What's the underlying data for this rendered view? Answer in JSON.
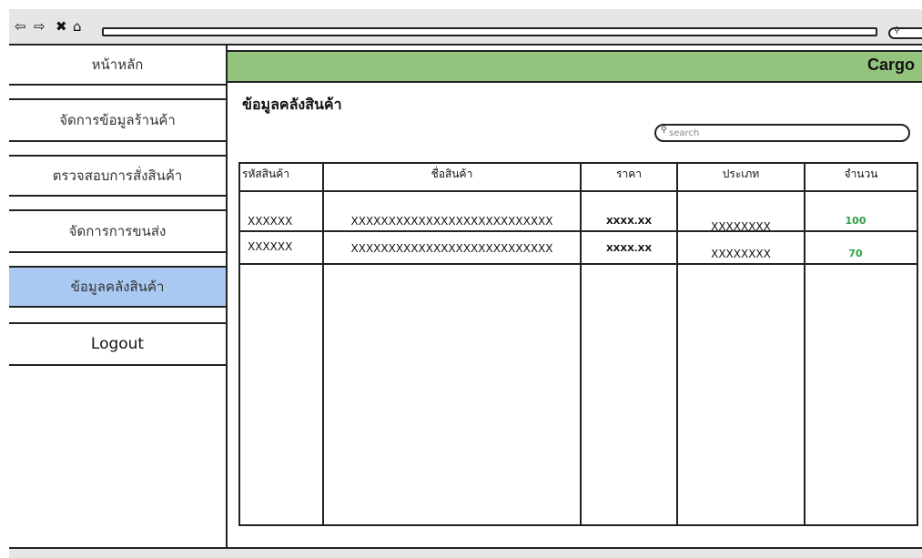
{
  "browser": {
    "icons": [
      "back-arrow-icon",
      "forward-arrow-icon",
      "close-icon",
      "home-icon",
      "search-icon"
    ]
  },
  "sidebar": {
    "items": [
      {
        "label": "หน้าหลัก",
        "active": false
      },
      {
        "label": "จัดการข้อมูลร้านค้า",
        "active": false
      },
      {
        "label": "ตรวจสอบการสั่งสินค้า",
        "active": false
      },
      {
        "label": "จัดการการขนส่ง",
        "active": false
      },
      {
        "label": "ข้อมูลคลังสินค้า",
        "active": true
      },
      {
        "label": "Logout",
        "active": false
      }
    ]
  },
  "header": {
    "brand": "Cargo",
    "color": "#93c47d"
  },
  "main": {
    "title": "ข้อมูลคลังสินค้า",
    "search": {
      "placeholder": "search"
    }
  },
  "table": {
    "columns": [
      "รหัสสินค้า",
      "ชื่อสินค้า",
      "ราคา",
      "ประเภท",
      "จำนวน"
    ],
    "rows": [
      {
        "code": "XXXXXX",
        "name": "XXXXXXXXXXXXXXXXXXXXXXXXXXX",
        "price": "XXXX.XX",
        "type": "XXXXXXXX",
        "qty": "100"
      },
      {
        "code": "XXXXXX",
        "name": "XXXXXXXXXXXXXXXXXXXXXXXXXXX",
        "price": "XXXX.XX",
        "type": "XXXXXXXX",
        "qty": "70"
      }
    ]
  },
  "colors": {
    "active_item": "#a9c8f2",
    "qty_text": "#2ea043"
  }
}
